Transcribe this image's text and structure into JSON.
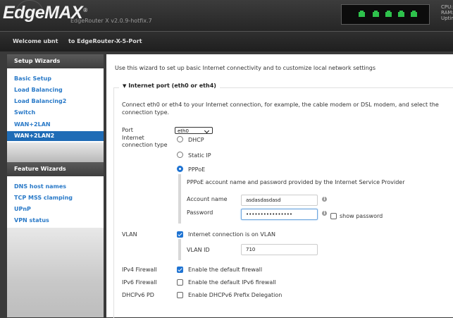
{
  "header": {
    "logo_text": "EdgeMAX",
    "logo_mark": "®",
    "version": "EdgeRouter X v2.0.9-hotfix.7",
    "stats": [
      "CPU:",
      "RAM:",
      "Uptim"
    ]
  },
  "nav": {
    "welcome": "Welcome ubnt",
    "back_link": "to EdgeRouter-X-5-Port"
  },
  "sidebar": {
    "setup_title": "Setup Wizards",
    "setup_items": [
      "Basic Setup",
      "Load Balancing",
      "Load Balancing2",
      "Switch",
      "WAN+2LAN",
      "WAN+2LAN2"
    ],
    "active_item": "WAN+2LAN2",
    "feature_title": "Feature Wizards",
    "feature_items": [
      "DNS host names",
      "TCP MSS clamping",
      "UPnP",
      "VPN status"
    ]
  },
  "main": {
    "intro": "Use this wizard to set up basic Internet connectivity and to customize local network settings",
    "section_title": "Internet port (eth0 or eth4)",
    "section_desc_1": "Connect eth0 or eth4 to your Internet connection, for example, the cable modem or DSL modem, and select the",
    "section_desc_2": "connection type.",
    "port_label": "Port",
    "port_value": "eth0",
    "conn_type_label_1": "Internet",
    "conn_type_label_2": "connection type",
    "conn_options": [
      "DHCP",
      "Static IP",
      "PPPoE"
    ],
    "conn_selected": "PPPoE",
    "pppoe_desc": "PPPoE account name and password provided by the Internet Service Provider",
    "account_label": "Account name",
    "account_value": "asdasdasdasd",
    "password_label": "Password",
    "password_value": "••••••••••••••••",
    "show_password_label": "show password",
    "vlan_label": "VLAN",
    "vlan_check_label": "Internet connection is on VLAN",
    "vlan_id_label": "VLAN ID",
    "vlan_id_value": "710",
    "ipv4_fw_label": "IPv4 Firewall",
    "ipv4_fw_check": "Enable the default firewall",
    "ipv6_fw_label": "IPv6 Firewall",
    "ipv6_fw_check": "Enable the default IPv6 firewall",
    "dhcpv6_label": "DHCPv6 PD",
    "dhcpv6_check": "Enable DHCPv6 Prefix Delegation"
  },
  "colors": {
    "accent": "#1e73d2",
    "link": "#2a7ac8",
    "port_led": "#2ec24c"
  }
}
